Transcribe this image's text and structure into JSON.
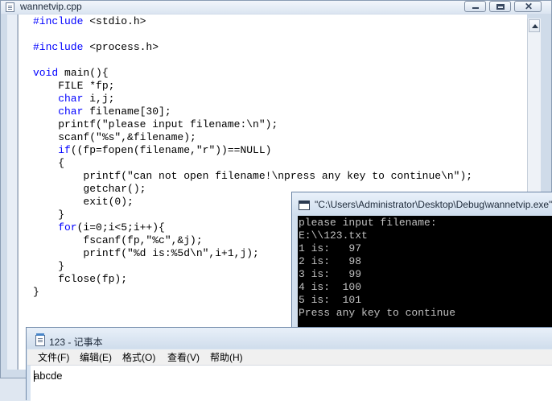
{
  "editor": {
    "title": "wannetvip.cpp",
    "lines": [
      [
        "#include",
        " <stdio.h>"
      ],
      [
        "",
        ""
      ],
      [
        "#include",
        " <process.h>"
      ],
      [
        "",
        ""
      ],
      [
        "void",
        " main(){"
      ],
      [
        "",
        "    FILE *fp;"
      ],
      [
        "    char",
        " i,j;"
      ],
      [
        "    char",
        " filename[30];"
      ],
      [
        "",
        "    printf(\"please input filename:\\n\");"
      ],
      [
        "",
        "    scanf(\"%s\",&filename);"
      ],
      [
        "    if",
        "((fp=fopen(filename,\"r\"))==NULL)"
      ],
      [
        "",
        "    {"
      ],
      [
        "",
        "        printf(\"can not open filename!\\npress any key to continue\\n\");"
      ],
      [
        "",
        "        getchar();"
      ],
      [
        "",
        "        exit(0);"
      ],
      [
        "",
        "    }"
      ],
      [
        "    for",
        "(i=0;i<5;i++){"
      ],
      [
        "",
        "        fscanf(fp,\"%c\",&j);"
      ],
      [
        "",
        "        printf(\"%d is:%5d\\n\",i+1,j);"
      ],
      [
        "",
        "    }"
      ],
      [
        "",
        "    fclose(fp);"
      ],
      [
        "",
        "}"
      ]
    ],
    "keyword_color": "#0000ff"
  },
  "console": {
    "title": "\"C:\\Users\\Administrator\\Desktop\\Debug\\wannetvip.exe\"",
    "output": [
      "please input filename:",
      "E:\\\\123.txt",
      "1 is:   97",
      "2 is:   98",
      "3 is:   99",
      "4 is:  100",
      "5 is:  101",
      "Press any key to continue"
    ]
  },
  "notepad": {
    "title": "123 - 记事本",
    "menu": {
      "file": "文件(F)",
      "edit": "编辑(E)",
      "format": "格式(O)",
      "view": "查看(V)",
      "help": "帮助(H)"
    },
    "content": "abcde"
  },
  "icons": {
    "editor": "document-icon",
    "console": "console-icon",
    "notepad": "notepad-icon"
  }
}
